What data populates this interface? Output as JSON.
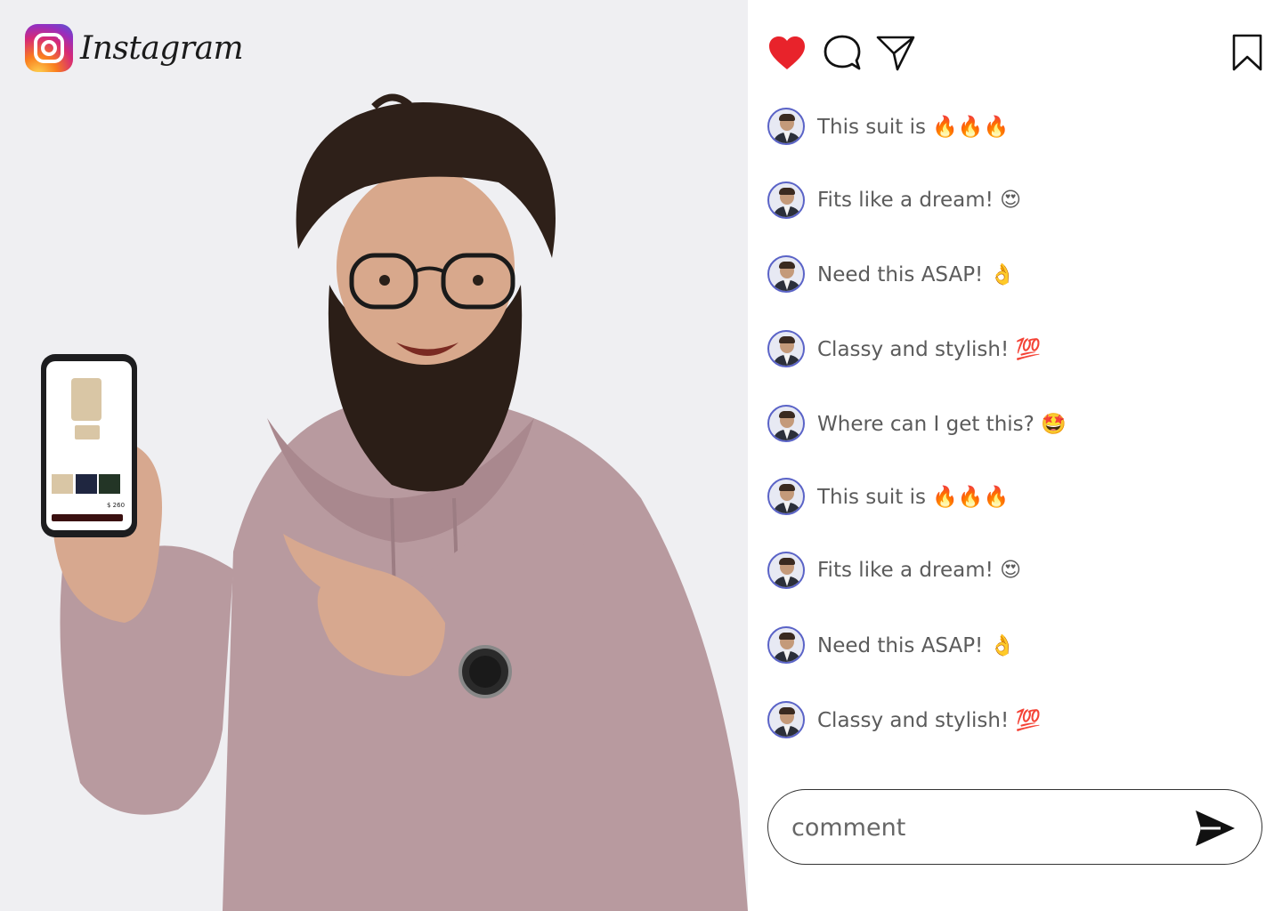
{
  "brand": {
    "name": "Instagram",
    "logo_icon": "instagram-logo-icon"
  },
  "actions": {
    "like_icon": "heart-filled-icon",
    "comment_icon": "comment-bubble-icon",
    "share_icon": "send-paper-plane-icon",
    "save_icon": "bookmark-icon",
    "like_color": "#e8232b"
  },
  "comments": [
    {
      "text": "This suit is 🔥🔥🔥"
    },
    {
      "text": "Fits like a dream! 😍"
    },
    {
      "text": "Need this ASAP! 👌"
    },
    {
      "text": "Classy and stylish! 💯"
    },
    {
      "text": "Where can I get this? 🤩"
    },
    {
      "text": "This suit is 🔥🔥🔥"
    },
    {
      "text": "Fits like a dream! 😍"
    },
    {
      "text": "Need this ASAP! 👌"
    },
    {
      "text": "Classy and stylish! 💯"
    }
  ],
  "composer": {
    "placeholder": "comment",
    "send_icon": "send-arrow-icon"
  },
  "phone_screen": {
    "price": "$ 260"
  },
  "colors": {
    "panel_bg": "#efeff2",
    "accent": "#5a63c7",
    "hoodie": "#b89a9f"
  }
}
